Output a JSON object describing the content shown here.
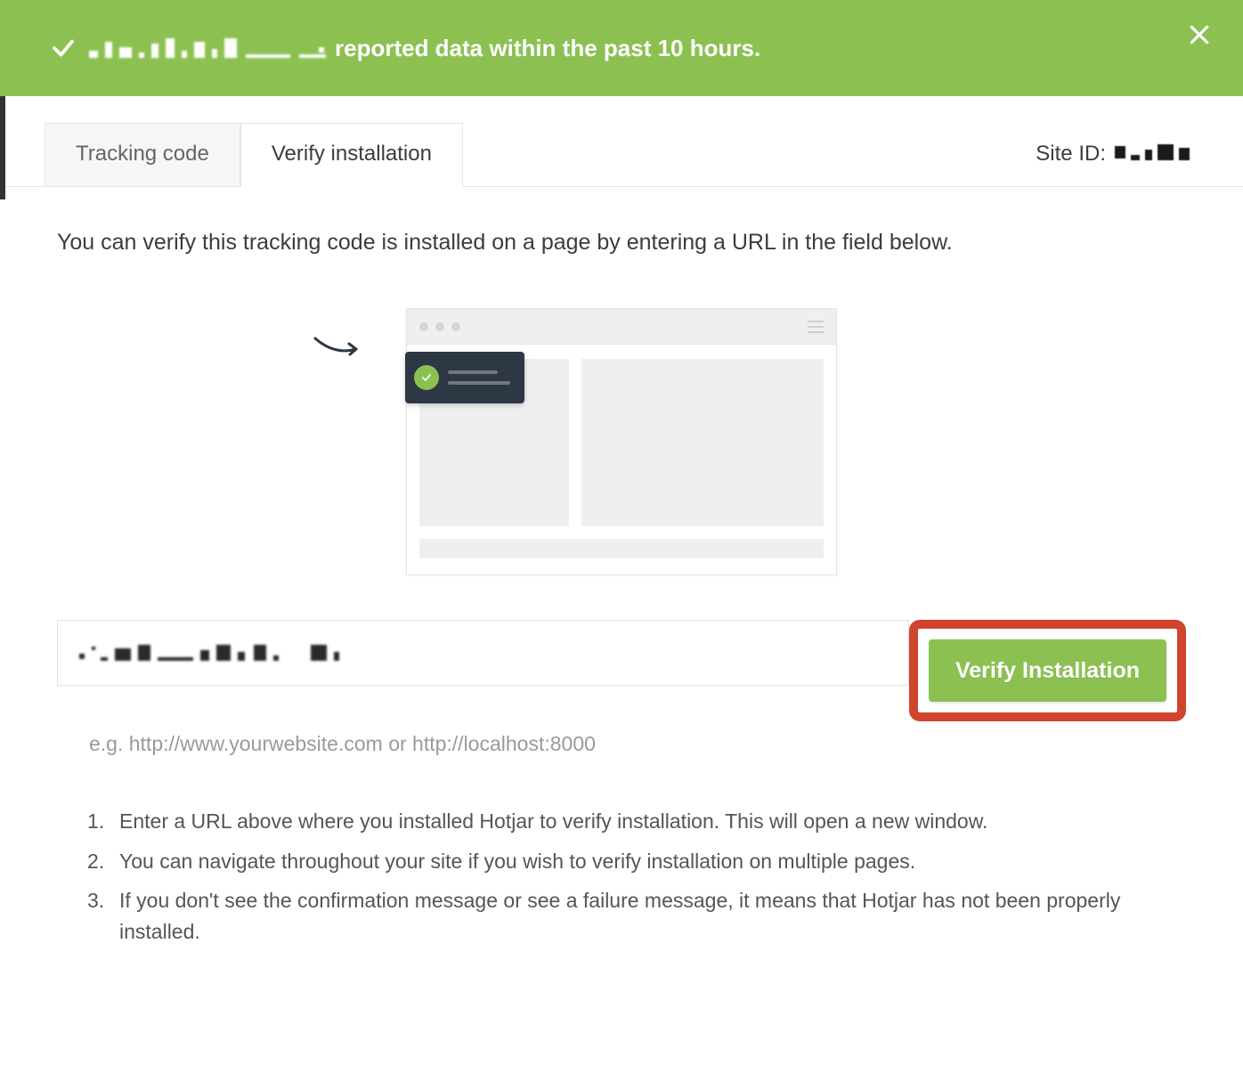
{
  "banner": {
    "message": "reported data within the past 10 hours."
  },
  "tabs": {
    "tracking": "Tracking code",
    "verify": "Verify installation"
  },
  "siteIdLabel": "Site ID:",
  "intro": "You can verify this tracking code is installed on a page by entering a URL in the field below.",
  "urlRow": {
    "buttonLabel": "Verify Installation",
    "hint": "e.g. http://www.yourwebsite.com or http://localhost:8000"
  },
  "steps": {
    "s1": "Enter a URL above where you installed Hotjar to verify installation. This will open a new window.",
    "s2": "You can navigate throughout your site if you wish to verify installation on multiple pages.",
    "s3": "If you don't see the confirmation message or see a failure message, it means that Hotjar has not been properly installed."
  },
  "colors": {
    "accent": "#8cc152",
    "highlight": "#d0442d"
  }
}
